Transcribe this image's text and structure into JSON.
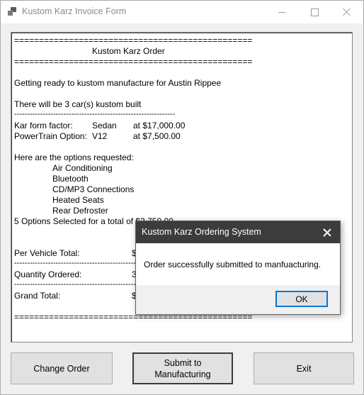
{
  "window": {
    "title": "Kustom Karz Invoice Form"
  },
  "invoice": {
    "separator_top": "================================================",
    "header": "Kustom Karz Order",
    "separator_header_bottom": "================================================",
    "customer_line": "Getting ready to kustom manufacture for Austin Rippee",
    "count_line": "There will be 3 car(s) kustom built",
    "dash_separator": "--------------------------------------------------------------",
    "form_factor_label": "Kar form factor:",
    "form_factor_value": "Sedan",
    "form_factor_price": "at $17,000.00",
    "powertrain_label": "PowerTrain Option:",
    "powertrain_value": "V12",
    "powertrain_price": "at $7,500.00",
    "options_header": "Here are the options requested:",
    "options": [
      "Air Conditioning",
      "Bluetooth",
      "CD/MP3 Connections",
      "Heated Seats",
      "Rear Defroster"
    ],
    "options_summary": "5 Options Selected for a total of $3,750.00",
    "per_vehicle_label": "Per Vehicle Total:",
    "per_vehicle_value": "$",
    "dash_separator_2": "----------------------------------------------------------------",
    "quantity_label": "Quantity Ordered:",
    "quantity_value": "3",
    "dash_separator_3": "----------------------------------------------------------------",
    "grand_total_label": "Grand Total:",
    "grand_total_value": "$",
    "separator_bottom": "================================================"
  },
  "buttons": {
    "change_order": "Change Order",
    "submit_line1": "Submit to",
    "submit_line2": "Manufacturing",
    "exit": "Exit"
  },
  "dialog": {
    "title": "Kustom Karz Ordering System",
    "message": "Order successfully submitted to manfuacturing.",
    "ok": "OK"
  }
}
